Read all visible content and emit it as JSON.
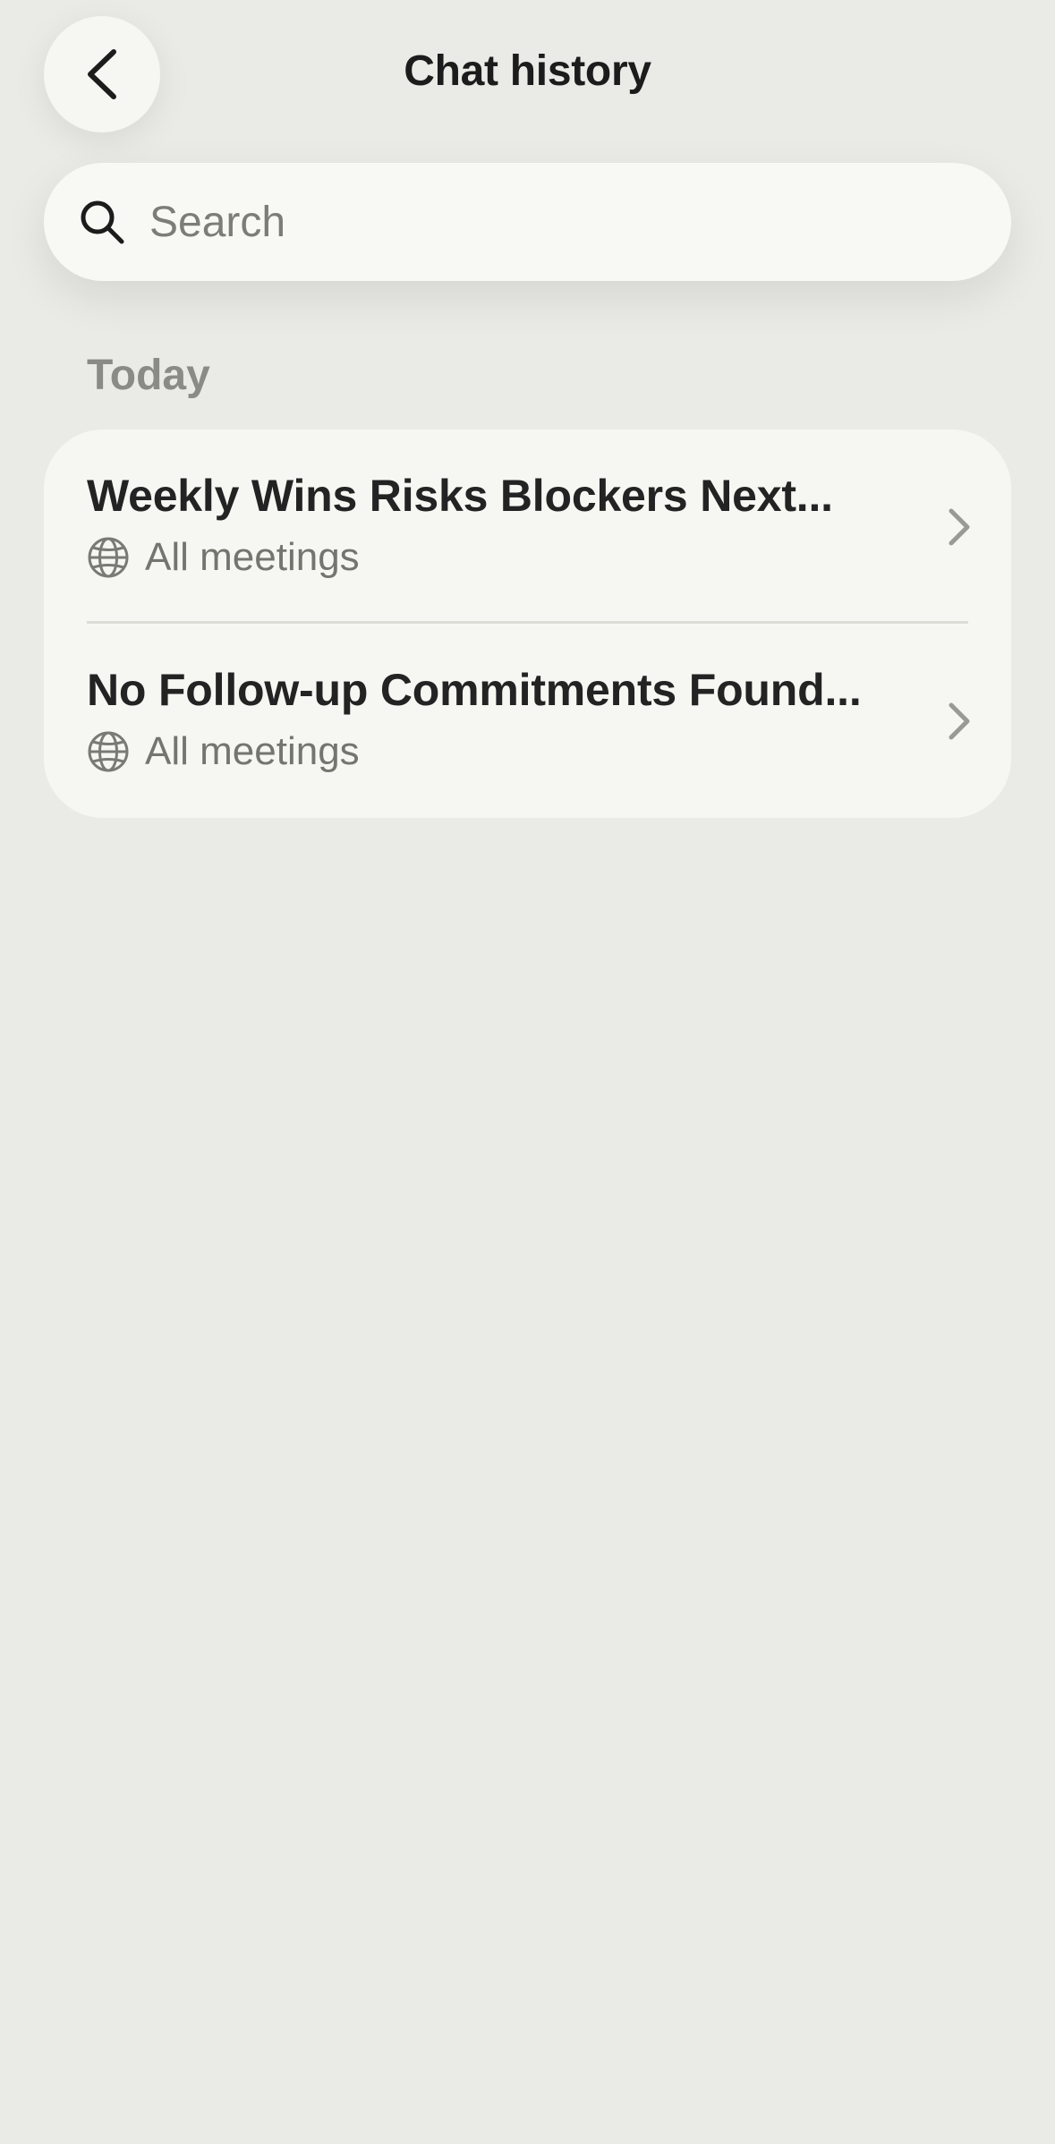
{
  "header": {
    "title": "Chat history",
    "back_icon": "chevron-left-icon"
  },
  "search": {
    "placeholder": "Search",
    "value": "",
    "icon": "search-icon"
  },
  "sections": [
    {
      "label": "Today",
      "items": [
        {
          "title": "Weekly Wins Risks Blockers Next...",
          "scope": "All meetings",
          "scope_icon": "globe-icon",
          "action_icon": "chevron-right-icon"
        },
        {
          "title": "No Follow-up Commitments Found...",
          "scope": "All meetings",
          "scope_icon": "globe-icon",
          "action_icon": "chevron-right-icon"
        }
      ]
    }
  ],
  "colors": {
    "background": "#eaeae6",
    "card": "#f6f6f2",
    "primary_text": "#232323",
    "secondary_text": "#75756f",
    "section_label": "#8a8a86"
  }
}
